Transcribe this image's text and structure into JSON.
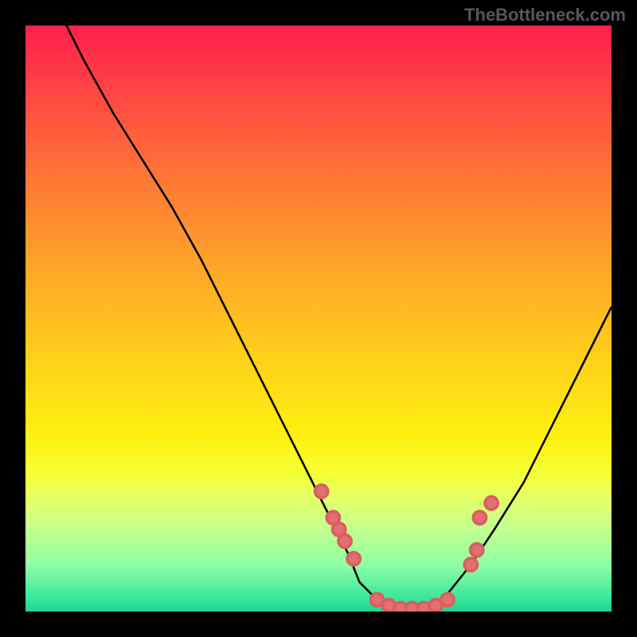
{
  "watermark": "TheBottleneck.com",
  "chart_data": {
    "type": "line",
    "title": "",
    "xlabel": "",
    "ylabel": "",
    "xlim": [
      0,
      100
    ],
    "ylim": [
      0,
      100
    ],
    "grid": false,
    "series": [
      {
        "name": "curve",
        "x": [
          0,
          5,
          10,
          15,
          20,
          25,
          30,
          35,
          40,
          45,
          50,
          55,
          57,
          60,
          64,
          68,
          72,
          76,
          80,
          85,
          90,
          95,
          100
        ],
        "y": [
          118,
          104,
          94,
          85,
          77,
          69,
          60,
          50,
          40,
          30,
          20,
          10,
          5,
          2,
          0,
          0,
          3,
          8,
          14,
          22,
          32,
          42,
          52
        ]
      }
    ],
    "points": {
      "name": "dots",
      "x": [
        50.5,
        52.5,
        53.5,
        54.5,
        56.0,
        60.0,
        62.0,
        64.0,
        66.0,
        68.0,
        70.0,
        72.0,
        76.0,
        77.0,
        77.5,
        79.5
      ],
      "y": [
        20.5,
        16.0,
        14.0,
        12.0,
        9.0,
        2.0,
        1.0,
        0.5,
        0.5,
        0.5,
        1.0,
        2.0,
        8.0,
        10.5,
        16.0,
        18.5
      ]
    },
    "colors": {
      "curve": "#000000",
      "dots": "#e27070",
      "gradient_top": "#ff1f4b",
      "gradient_mid": "#ffd31a",
      "gradient_bottom": "#1fd391",
      "frame": "#000000"
    }
  }
}
